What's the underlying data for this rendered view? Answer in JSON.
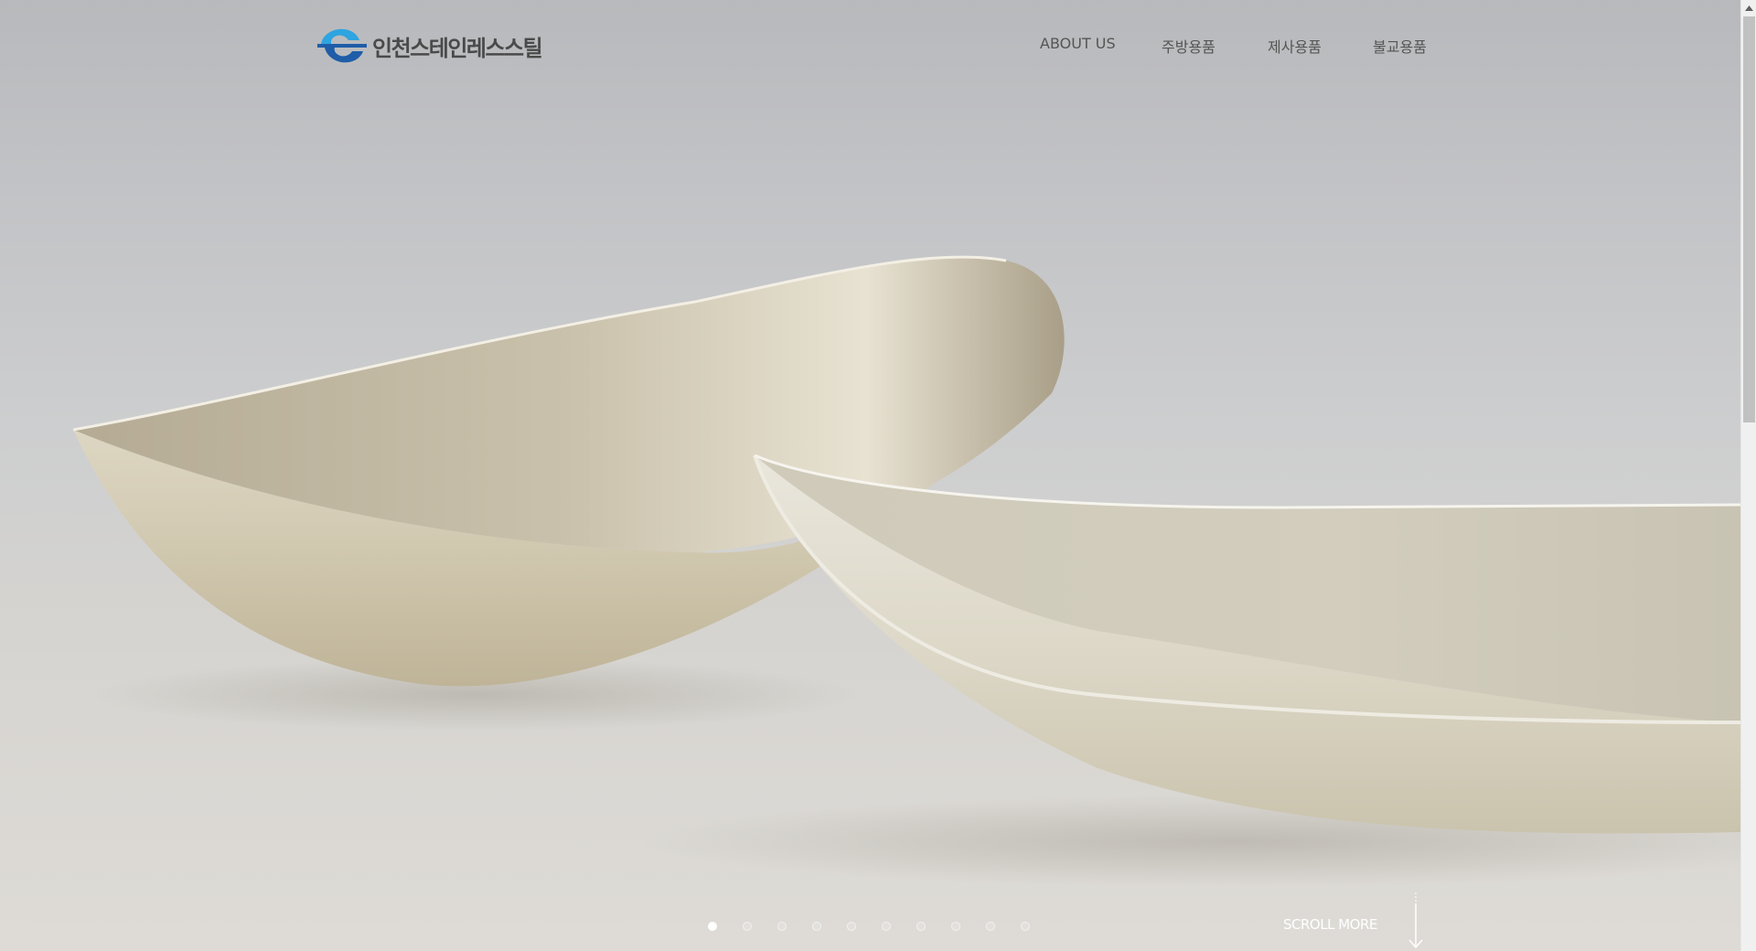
{
  "header": {
    "logo_text": "인천스테인레스스틸",
    "logo_icon": "company-logo-icon",
    "nav": [
      {
        "label": "ABOUT US"
      },
      {
        "label": "주방용품"
      },
      {
        "label": "제사용품"
      },
      {
        "label": "불교용품"
      }
    ]
  },
  "slider": {
    "total_slides": 10,
    "active_slide": 1
  },
  "scroll_more": {
    "label": "SCROLL MORE",
    "icon": "arrow-down-icon"
  },
  "colors": {
    "logo_blue_dark": "#1f5da8",
    "logo_blue_light": "#2ea4e0",
    "nav_text": "#555555"
  }
}
